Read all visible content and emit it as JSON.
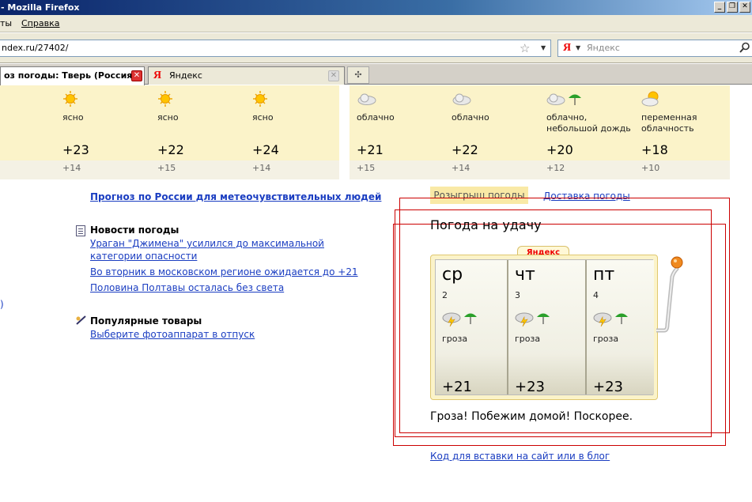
{
  "window": {
    "title": "- Mozilla Firefox",
    "buttons": [
      "_",
      "❐",
      "✕"
    ]
  },
  "menubar": {
    "item_tools": "ты",
    "item_help": "Справка"
  },
  "navbar": {
    "url": "ndex.ru/27402/",
    "search_placeholder": "Яндекс",
    "search_engine_logo": "Я"
  },
  "tabs": [
    {
      "label": "оз погоды: Тверь (Россия...",
      "active": true
    },
    {
      "label": "Яндекс",
      "active": false
    }
  ],
  "forecast_left": [
    {
      "condition": "ясно",
      "icon": "sun",
      "day": "+23",
      "night": "+14"
    },
    {
      "condition": "ясно",
      "icon": "sun",
      "day": "+22",
      "night": "+15"
    },
    {
      "condition": "ясно",
      "icon": "sun",
      "day": "+24",
      "night": "+14"
    }
  ],
  "forecast_right": [
    {
      "condition": "облачно",
      "icon": "cloud",
      "day": "+21",
      "night": "+15"
    },
    {
      "condition": "облачно",
      "icon": "cloud",
      "day": "+22",
      "night": "+14"
    },
    {
      "condition": "облачно, небольшой дождь",
      "icon": "cloud-rain",
      "day": "+20",
      "night": "+12"
    },
    {
      "condition": "переменная облачность",
      "icon": "partly-cloudy",
      "day": "+18",
      "night": "+10"
    }
  ],
  "links": {
    "russia_forecast": "Прогноз по России для метеочувствительных людей",
    "edge_link": ")"
  },
  "news": {
    "title": "Новости погоды",
    "items": [
      "Ураган \"Джимена\" усилился до максимальной категории опасности",
      "Во вторник в московском регионе ожидается до +21",
      "Половина Полтавы осталась без света"
    ]
  },
  "products": {
    "title": "Популярные товары",
    "link": "Выберите фотоаппарат в отпуск"
  },
  "promo": {
    "tab_active": "Розыгрыш погоды",
    "tab_link": "Доставка погоды",
    "title": "Погода на удачу",
    "badge": "Яндекс",
    "reels": [
      {
        "day": "ср",
        "num": "2",
        "condition": "гроза",
        "temp": "+21"
      },
      {
        "day": "чт",
        "num": "3",
        "condition": "гроза",
        "temp": "+23"
      },
      {
        "day": "пт",
        "num": "4",
        "condition": "гроза",
        "temp": "+23"
      }
    ],
    "message": "Гроза! Побежим домой! Поскорее.",
    "embed_link": "Код для вставки на сайт или в блог"
  }
}
